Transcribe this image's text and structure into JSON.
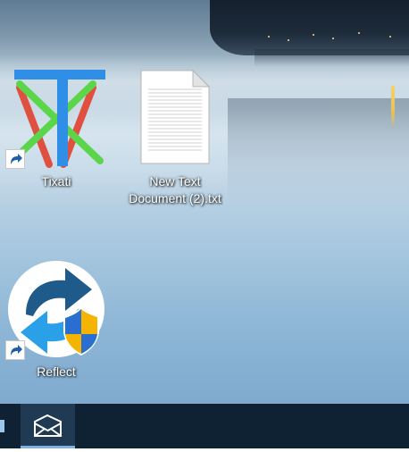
{
  "desktop": {
    "icons": [
      {
        "label": "Tixati",
        "icon": "tixati-icon",
        "shortcut": true
      },
      {
        "label": "New Text Document (2).txt",
        "label_lines": [
          "New Text",
          "Document (2).txt"
        ],
        "icon": "text-document-icon",
        "shortcut": false
      },
      {
        "label": "Reflect",
        "icon": "reflect-icon",
        "shortcut": true
      }
    ]
  },
  "taskbar": {
    "items": [
      {
        "name": "partial-taskbar-icon"
      },
      {
        "name": "mail-icon",
        "active": true
      }
    ]
  },
  "colors": {
    "taskbar_bg": "#0e2233",
    "active_item_bg": "#1f3a52",
    "active_underline": "#7fb2de",
    "tixati_blue": "#2f8fe6",
    "tixati_green": "#5bd64a",
    "tixati_red": "#e05040"
  }
}
